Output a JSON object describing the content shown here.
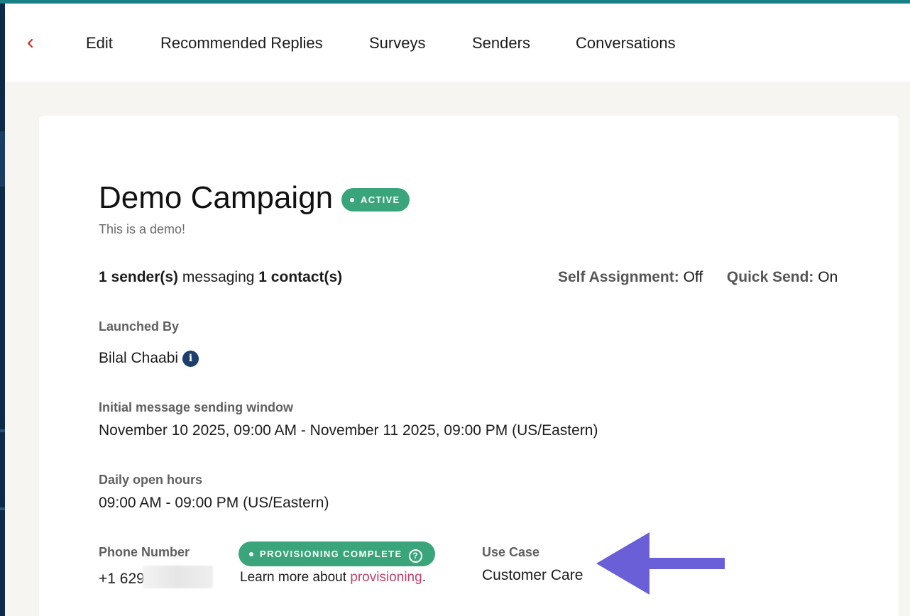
{
  "nav": {
    "back_icon": "chevron-left-icon",
    "tabs": [
      "Edit",
      "Recommended Replies",
      "Surveys",
      "Senders",
      "Conversations"
    ]
  },
  "campaign": {
    "title": "Demo Campaign",
    "status": "ACTIVE",
    "description": "This is a demo!",
    "stats": {
      "senders": "1 sender(s)",
      "messaging": "messaging",
      "contacts": "1 contact(s)"
    },
    "self_assignment_label": "Self Assignment:",
    "self_assignment_value": "Off",
    "quick_send_label": "Quick Send:",
    "quick_send_value": "On",
    "launched_by_label": "Launched By",
    "launched_by_value": "Bilal Chaabi",
    "window_label": "Initial message sending window",
    "window_value": "November 10 2025, 09:00 AM - November 11 2025, 09:00 PM (US/Eastern)",
    "hours_label": "Daily open hours",
    "hours_value": "09:00 AM - 09:00 PM (US/Eastern)",
    "phone_label": "Phone Number",
    "phone_value": "+1 629",
    "provisioning_status": "PROVISIONING COMPLETE",
    "learn_prefix": "Learn more about",
    "learn_link": "provisioning",
    "learn_suffix": ".",
    "use_case_label": "Use Case",
    "use_case_value": "Customer Care"
  },
  "colors": {
    "accent_green": "#3aa57a",
    "link_pink": "#c4416a",
    "annotation_arrow": "#6a5fd6",
    "back_red": "#c8321f",
    "info_navy": "#1e3f6e"
  }
}
